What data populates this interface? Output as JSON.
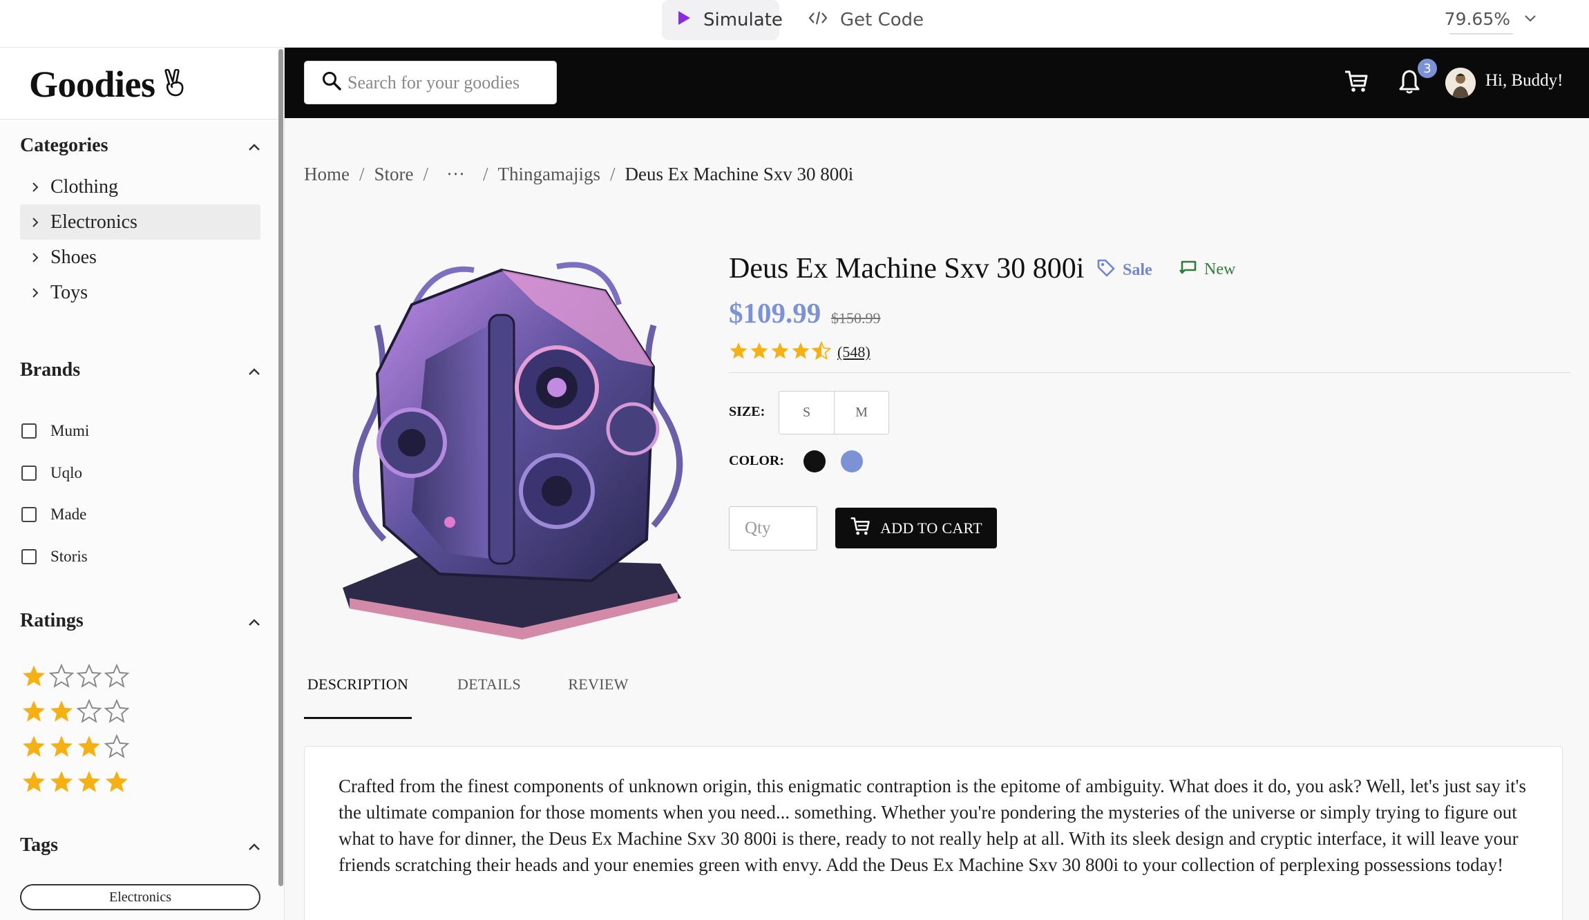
{
  "toolbar": {
    "simulate_label": "Simulate",
    "get_code_label": "Get Code",
    "zoom": "79.65%"
  },
  "sidebar": {
    "logo": "Goodies",
    "logo_icon": "victory-hand-icon",
    "categories": {
      "title": "Categories",
      "items": [
        {
          "label": "Clothing",
          "active": false
        },
        {
          "label": "Electronics",
          "active": true
        },
        {
          "label": "Shoes",
          "active": false
        },
        {
          "label": "Toys",
          "active": false
        }
      ]
    },
    "brands": {
      "title": "Brands",
      "items": [
        "Mumi",
        "Uqlo",
        "Made",
        "Storis"
      ]
    },
    "ratings": {
      "title": "Ratings",
      "rows": [
        1,
        2,
        3,
        4
      ],
      "max": 4
    },
    "tags": {
      "title": "Tags",
      "items": [
        "Electronics"
      ]
    }
  },
  "header": {
    "search_placeholder": "Search for your goodies",
    "notification_count": "3",
    "greeting": "Hi, Buddy!"
  },
  "breadcrumb": {
    "items": [
      "Home",
      "Store",
      "···",
      "Thingamajigs"
    ],
    "current": "Deus Ex Machine Sxv 30 800i"
  },
  "product": {
    "title": "Deus Ex Machine Sxv 30 800i",
    "sale_label": "Sale",
    "new_label": "New",
    "price": "$109.99",
    "old_price": "$150.99",
    "rating": 4.5,
    "review_count": "(548)",
    "size_label": "SIZE:",
    "sizes": [
      "S",
      "M"
    ],
    "color_label": "COLOR:",
    "colors": [
      "#111111",
      "#7b93d6"
    ],
    "qty_placeholder": "Qty",
    "add_to_cart_label": "ADD TO CART"
  },
  "tabs": {
    "items": [
      "DESCRIPTION",
      "DETAILS",
      "REVIEW"
    ],
    "active": 0
  },
  "description": "Crafted from the finest components of unknown origin, this enigmatic contraption is the epitome of ambiguity. What does it do, you ask? Well, let's just say it's the ultimate companion for those moments when you need... something. Whether you're pondering the mysteries of the universe or simply trying to figure out what to have for dinner, the Deus Ex Machine Sxv 30 800i is there, ready to not really help at all. With its sleek design and cryptic interface, it will leave your friends scratching their heads and your enemies green with envy. Add the Deus Ex Machine Sxv 30 800i to your collection of perplexing possessions today!",
  "colors": {
    "accent": "#7b93d6",
    "star": "#f5b014",
    "header_bg": "#0a0a0a",
    "new_green": "#2f7d3a"
  }
}
